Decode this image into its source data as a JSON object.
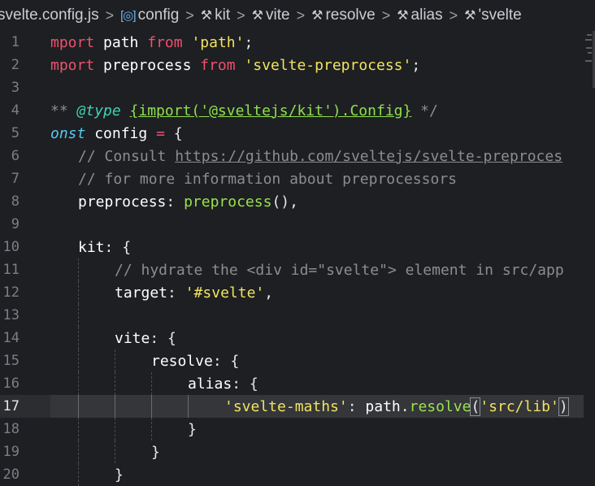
{
  "breadcrumb": [
    {
      "label": "svelte.config.js",
      "icon": "",
      "icon_name": "file-icon"
    },
    {
      "label": "config",
      "icon": "[◎]",
      "icon_name": "object-icon"
    },
    {
      "label": "kit",
      "icon": "🔧",
      "icon_name": "wrench-icon"
    },
    {
      "label": "vite",
      "icon": "🔧",
      "icon_name": "wrench-icon"
    },
    {
      "label": "resolve",
      "icon": "🔧",
      "icon_name": "wrench-icon"
    },
    {
      "label": "alias",
      "icon": "🔧",
      "icon_name": "wrench-icon"
    },
    {
      "label": "'svelte",
      "icon": "🔧",
      "icon_name": "wrench-icon"
    }
  ],
  "editor": {
    "active_line": 17,
    "lines": [
      {
        "n": "1",
        "indent": 0,
        "tokens": [
          [
            "kw",
            "mport"
          ],
          [
            "punc",
            " "
          ],
          [
            "id",
            "path"
          ],
          [
            "punc",
            " "
          ],
          [
            "kw",
            "from"
          ],
          [
            "punc",
            " "
          ],
          [
            "str",
            "'path'"
          ],
          [
            "punc",
            ";"
          ]
        ]
      },
      {
        "n": "2",
        "indent": 0,
        "tokens": [
          [
            "kw",
            "mport"
          ],
          [
            "punc",
            " "
          ],
          [
            "id",
            "preprocess"
          ],
          [
            "punc",
            " "
          ],
          [
            "kw",
            "from"
          ],
          [
            "punc",
            " "
          ],
          [
            "str",
            "'svelte-preprocess'"
          ],
          [
            "punc",
            ";"
          ]
        ]
      },
      {
        "n": "3",
        "indent": 0,
        "tokens": []
      },
      {
        "n": "4",
        "indent": 0,
        "tokens": [
          [
            "cmtdoc",
            "** "
          ],
          [
            "tag",
            "@type"
          ],
          [
            "punc",
            " "
          ],
          [
            "type",
            "{import('@sveltejs/kit').Config}"
          ],
          [
            "cmtdoc",
            " */"
          ]
        ]
      },
      {
        "n": "5",
        "indent": 0,
        "tokens": [
          [
            "it",
            "onst"
          ],
          [
            "punc",
            " "
          ],
          [
            "id",
            "config"
          ],
          [
            "punc",
            " "
          ],
          [
            "op",
            "="
          ],
          [
            "punc",
            " {"
          ]
        ]
      },
      {
        "n": "6",
        "indent": 1,
        "tokens": [
          [
            "cmt",
            "// Consult "
          ],
          [
            "link",
            "https://github.com/sveltejs/svelte-preproces"
          ]
        ]
      },
      {
        "n": "7",
        "indent": 1,
        "tokens": [
          [
            "cmt",
            "// for more information about preprocessors"
          ]
        ]
      },
      {
        "n": "8",
        "indent": 1,
        "tokens": [
          [
            "prop",
            "preprocess"
          ],
          [
            "punc",
            ": "
          ],
          [
            "fn",
            "preprocess"
          ],
          [
            "punc",
            "(),"
          ]
        ]
      },
      {
        "n": "9",
        "indent": 1,
        "tokens": []
      },
      {
        "n": "10",
        "indent": 1,
        "tokens": [
          [
            "prop",
            "kit"
          ],
          [
            "punc",
            ": {"
          ]
        ]
      },
      {
        "n": "11",
        "indent": 2,
        "tokens": [
          [
            "cmt",
            "// hydrate the <div id=\"svelte\"> element in src/app"
          ]
        ]
      },
      {
        "n": "12",
        "indent": 2,
        "tokens": [
          [
            "prop",
            "target"
          ],
          [
            "punc",
            ": "
          ],
          [
            "str",
            "'#svelte'"
          ],
          [
            "punc",
            ","
          ]
        ]
      },
      {
        "n": "13",
        "indent": 2,
        "tokens": []
      },
      {
        "n": "14",
        "indent": 2,
        "tokens": [
          [
            "prop",
            "vite"
          ],
          [
            "punc",
            ": {"
          ]
        ]
      },
      {
        "n": "15",
        "indent": 3,
        "tokens": [
          [
            "prop",
            "resolve"
          ],
          [
            "punc",
            ": {"
          ]
        ]
      },
      {
        "n": "16",
        "indent": 4,
        "tokens": [
          [
            "prop",
            "alias"
          ],
          [
            "punc",
            ": {"
          ]
        ]
      },
      {
        "n": "17",
        "indent": 5,
        "tokens": [
          [
            "str",
            "'svelte-maths'"
          ],
          [
            "punc",
            ": "
          ],
          [
            "id",
            "path"
          ],
          [
            "punc",
            "."
          ],
          [
            "fn",
            "resolve"
          ],
          [
            "brk",
            "("
          ],
          [
            "str",
            "'src/lib'"
          ],
          [
            "brk",
            ")"
          ]
        ]
      },
      {
        "n": "18",
        "indent": 4,
        "tokens": [
          [
            "punc",
            "}"
          ]
        ]
      },
      {
        "n": "19",
        "indent": 3,
        "tokens": [
          [
            "punc",
            "}"
          ]
        ]
      },
      {
        "n": "20",
        "indent": 2,
        "tokens": [
          [
            "punc",
            "}"
          ]
        ]
      }
    ]
  },
  "colors": {
    "background": "#1d1f22",
    "keyword": "#f0506e",
    "string": "#f2e35f",
    "function": "#9be24d",
    "comment": "#8a8d91",
    "italic_keyword": "#57c9f1",
    "doc_tag": "#3fd1b4"
  }
}
